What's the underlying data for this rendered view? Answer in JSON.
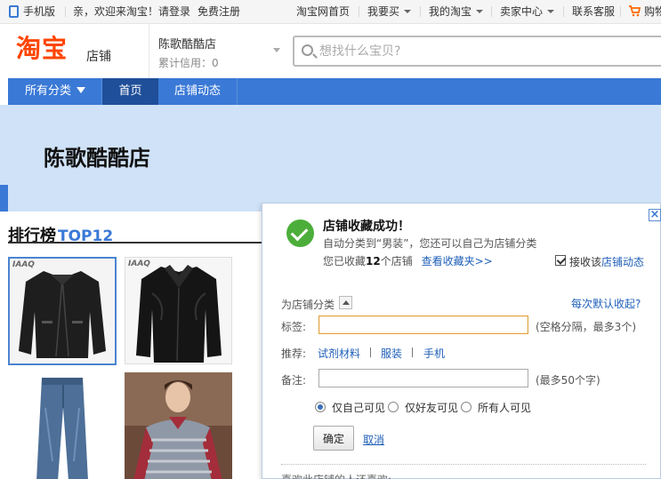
{
  "topbar": {
    "mobile": "手机版",
    "welcome": "亲，欢迎来淘宝！请",
    "login": "登录",
    "register": "免费注册",
    "home": "淘宝网首页",
    "buy": "我要买",
    "my_taobao": "我的淘宝",
    "seller_center": "卖家中心",
    "service": "联系客服",
    "cart": "购物"
  },
  "header": {
    "logo": "淘宝",
    "logo_sub": "店铺",
    "shop_name": "陈歌酷酷店",
    "credit": "累计信用：0",
    "search_placeholder": "想找什么宝贝?"
  },
  "nav": {
    "all_categories": "所有分类",
    "home": "首页",
    "shop_news": "店铺动态"
  },
  "banner": {
    "title": "陈歌酷酷店"
  },
  "ranking": {
    "title": "排行榜",
    "top": "TOP12",
    "products": [
      {
        "brand": "IAAQ",
        "type": "leather-jacket"
      },
      {
        "brand": "IAAQ",
        "type": "leather-coat"
      },
      {
        "brand": "",
        "type": "jeans"
      },
      {
        "brand": "",
        "type": "sweater-model"
      }
    ]
  },
  "popup": {
    "title": "店铺收藏成功！",
    "line1": "自动分类到“男装”，您还可以自己为店铺分类",
    "line2_prefix": "您已收藏",
    "line2_count": "12",
    "line2_suffix": "个店铺",
    "view_favorites": "查看收藏夹>>",
    "subscribe_checked": true,
    "subscribe_prefix": "接收该",
    "subscribe_link": "店铺动态",
    "classify_label": "为店铺分类",
    "default_collapse": "每次默认收起?",
    "tag_label": "标签:",
    "tag_value": "",
    "tag_hint": "(空格分隔，最多3个)",
    "recommend_label": "推荐:",
    "recommend": [
      "试剂材料",
      "服装",
      "手机"
    ],
    "note_label": "备注:",
    "note_value": "",
    "note_hint": "(最多50个字)",
    "visibility": [
      "仅自己可见",
      "仅好友可见",
      "所有人可见"
    ],
    "visibility_selected": 0,
    "ok": "确定",
    "cancel": "取消",
    "footer": "喜欢此店铺的人还喜欢:"
  }
}
